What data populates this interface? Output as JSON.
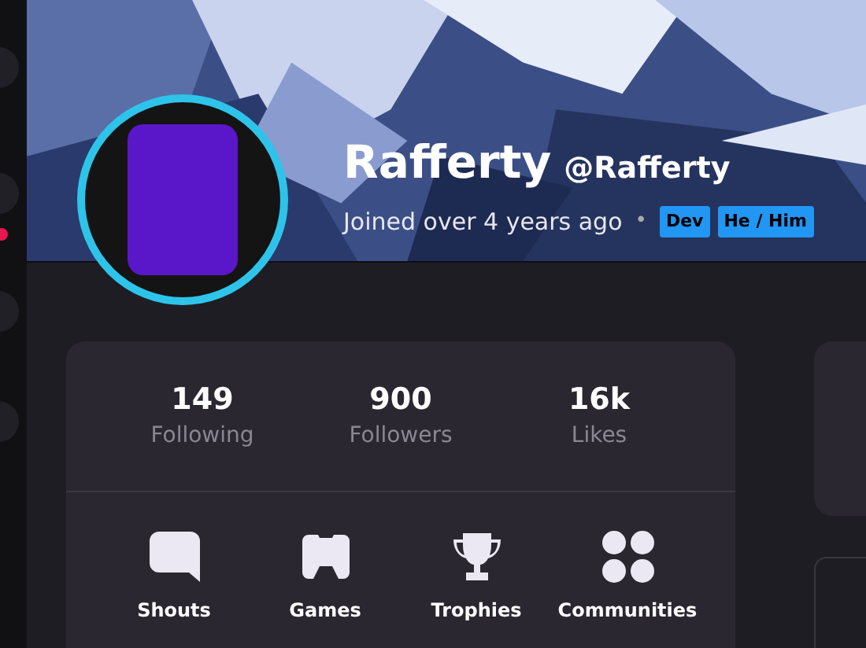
{
  "profile": {
    "display_name": "Rafferty",
    "username": "@Rafferty",
    "joined": "Joined over 4 years ago",
    "separator": "•",
    "badges": [
      "Dev",
      "He / Him"
    ]
  },
  "stats": [
    {
      "value": "149",
      "label": "Following"
    },
    {
      "value": "900",
      "label": "Followers"
    },
    {
      "value": "16k",
      "label": "Likes"
    }
  ],
  "sections": [
    {
      "kind": "shouts",
      "label": "Shouts"
    },
    {
      "kind": "games",
      "label": "Games"
    },
    {
      "kind": "trophies",
      "label": "Trophies"
    },
    {
      "kind": "communities",
      "label": "Communities"
    }
  ]
}
